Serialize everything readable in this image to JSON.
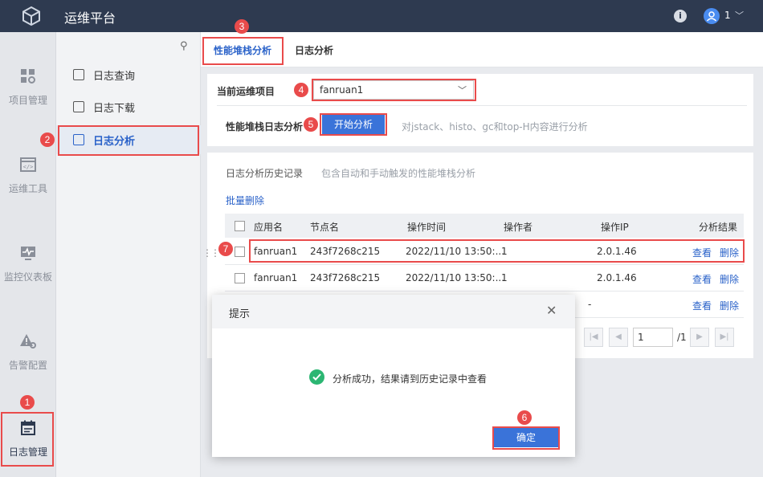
{
  "header": {
    "title": "运维平台",
    "user": "1",
    "info_icon": "info-icon",
    "chevron": "﹀"
  },
  "leftnav": [
    {
      "label": "项目管理",
      "icon": "grid-gear-icon"
    },
    {
      "label": "运维工具",
      "icon": "code-window-icon"
    },
    {
      "label": "监控仪表板",
      "icon": "monitor-icon"
    },
    {
      "label": "告警配置",
      "icon": "alert-gear-icon"
    },
    {
      "label": "日志管理",
      "icon": "log-icon",
      "active": true
    }
  ],
  "submenu": [
    {
      "label": "日志查询",
      "icon": "log-search-icon"
    },
    {
      "label": "日志下载",
      "icon": "log-download-icon"
    },
    {
      "label": "日志分析",
      "icon": "log-analysis-icon",
      "active": true
    }
  ],
  "tabs": [
    {
      "label": "性能堆栈分析",
      "active": true
    },
    {
      "label": "日志分析"
    }
  ],
  "form": {
    "project_label": "当前运维项目",
    "project_value": "fanruan1",
    "stack_label": "性能堆栈日志分析",
    "start_button": "开始分析",
    "start_hint": "对jstack、histo、gc和top-H内容进行分析"
  },
  "history": {
    "title": "日志分析历史记录",
    "subtitle": "包含自动和手动触发的性能堆栈分析",
    "batch_delete": "批量删除",
    "columns": [
      "应用名",
      "节点名",
      "操作时间",
      "操作者",
      "操作IP",
      "分析结果"
    ],
    "rows": [
      {
        "app": "fanruan1",
        "node": "243f7268c215",
        "time": "2022/11/10 13:50:...",
        "operator": "1",
        "ip": "2.0.1.46",
        "view": "查看",
        "delete": "删除"
      },
      {
        "app": "fanruan1",
        "node": "243f7268c215",
        "time": "2022/11/10 13:50:...",
        "operator": "1",
        "ip": "2.0.1.46",
        "view": "查看",
        "delete": "删除"
      },
      {
        "ip": "-",
        "view": "查看",
        "delete": "删除"
      }
    ],
    "pager": {
      "page": "1",
      "total": "/1"
    }
  },
  "dialog": {
    "title": "提示",
    "message": "分析成功，结果请到历史记录中查看",
    "ok_button": "确定"
  },
  "annotations": [
    "1",
    "2",
    "3",
    "4",
    "5",
    "6",
    "7"
  ],
  "colors": {
    "topbar": "#2e3a50",
    "accent": "#3a73d9",
    "annotation": "#e94b4b",
    "success": "#2bb672"
  }
}
